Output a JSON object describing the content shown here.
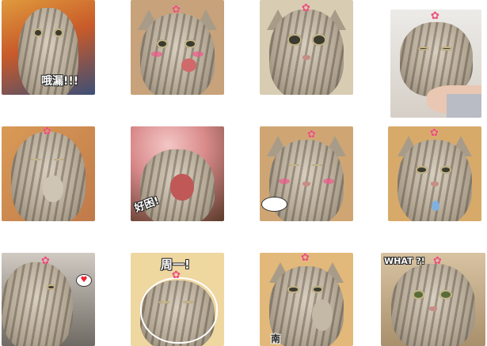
{
  "tiles": [
    {
      "name": "cat-sticker-scream",
      "caption": "哦漏!!!",
      "bg": "#d07a3a",
      "caption_style": "light"
    },
    {
      "name": "cat-sticker-tongue",
      "caption": "",
      "bg": "#c4a37e"
    },
    {
      "name": "cat-sticker-big-eyes",
      "caption": "",
      "bg": "#d6c9ad"
    },
    {
      "name": "cat-sticker-held",
      "caption": "",
      "bg": "#dcd6ce"
    },
    {
      "name": "cat-sticker-thinking",
      "caption": "",
      "bg": "#c28a57"
    },
    {
      "name": "cat-sticker-yawn",
      "caption": "好困!",
      "bg": "#d89a9a",
      "caption_style": "dark"
    },
    {
      "name": "cat-sticker-wink",
      "caption": "",
      "bg": "#caa271"
    },
    {
      "name": "cat-sticker-tear",
      "caption": "",
      "bg": "#d7a76a"
    },
    {
      "name": "cat-sticker-love",
      "caption": "",
      "bg": "#6f6a63"
    },
    {
      "name": "cat-sticker-monday",
      "caption": "周一!",
      "bg": "#ecd29a",
      "caption_style": "dark"
    },
    {
      "name": "cat-sticker-paw",
      "caption": "南",
      "bg": "#e0b778",
      "caption_style": "dark"
    },
    {
      "name": "cat-sticker-what",
      "caption": "WHAT ?!",
      "bg": "#cbb28f",
      "caption_style": "light"
    }
  ],
  "flower_glyph": "✿",
  "heart_glyph": "♥",
  "accent_pink": "#e8517a"
}
